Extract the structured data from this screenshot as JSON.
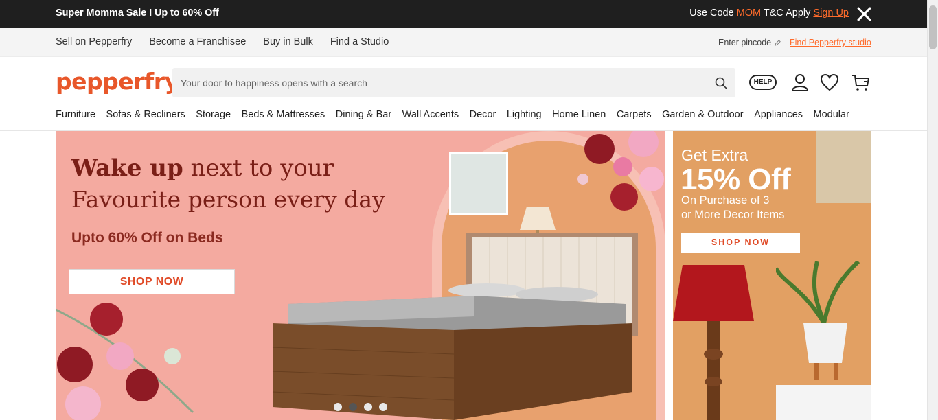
{
  "promo": {
    "left_text": "Super Momma Sale I Up to 60% Off",
    "use_code": "Use Code ",
    "code": "MOM",
    "tc": " T&C Apply ",
    "signup": "Sign Up"
  },
  "util": {
    "links": [
      "Sell on Pepperfry",
      "Become a Franchisee",
      "Buy in Bulk",
      "Find a Studio"
    ],
    "pincode": "Enter pincode",
    "studio": "Find Pepperfry studio"
  },
  "header": {
    "logo": "pepperfry",
    "search_placeholder": "Your door to happiness opens with a search",
    "help": "HELP"
  },
  "nav": [
    "Furniture",
    "Sofas & Recliners",
    "Storage",
    "Beds & Mattresses",
    "Dining & Bar",
    "Wall Accents",
    "Decor",
    "Lighting",
    "Home Linen",
    "Carpets",
    "Garden & Outdoor",
    "Appliances",
    "Modular"
  ],
  "hero": {
    "title_bold": "Wake up",
    "title_rest": " next to your",
    "title_line2": "Favourite person every day",
    "subtitle": "Upto 60% Off on Beds",
    "cta": "SHOP NOW",
    "slides": 4,
    "active_slide": 2
  },
  "side": {
    "line1": "Get Extra",
    "line2": "15% Off",
    "line3": "On Purchase of 3",
    "line4": "or More Decor Items",
    "cta": "SHOP NOW"
  },
  "colors": {
    "accent": "#ff6b2b",
    "logo": "#e8572a",
    "hero_bg": "#f4aaa0",
    "side_bg": "#e2a063"
  }
}
